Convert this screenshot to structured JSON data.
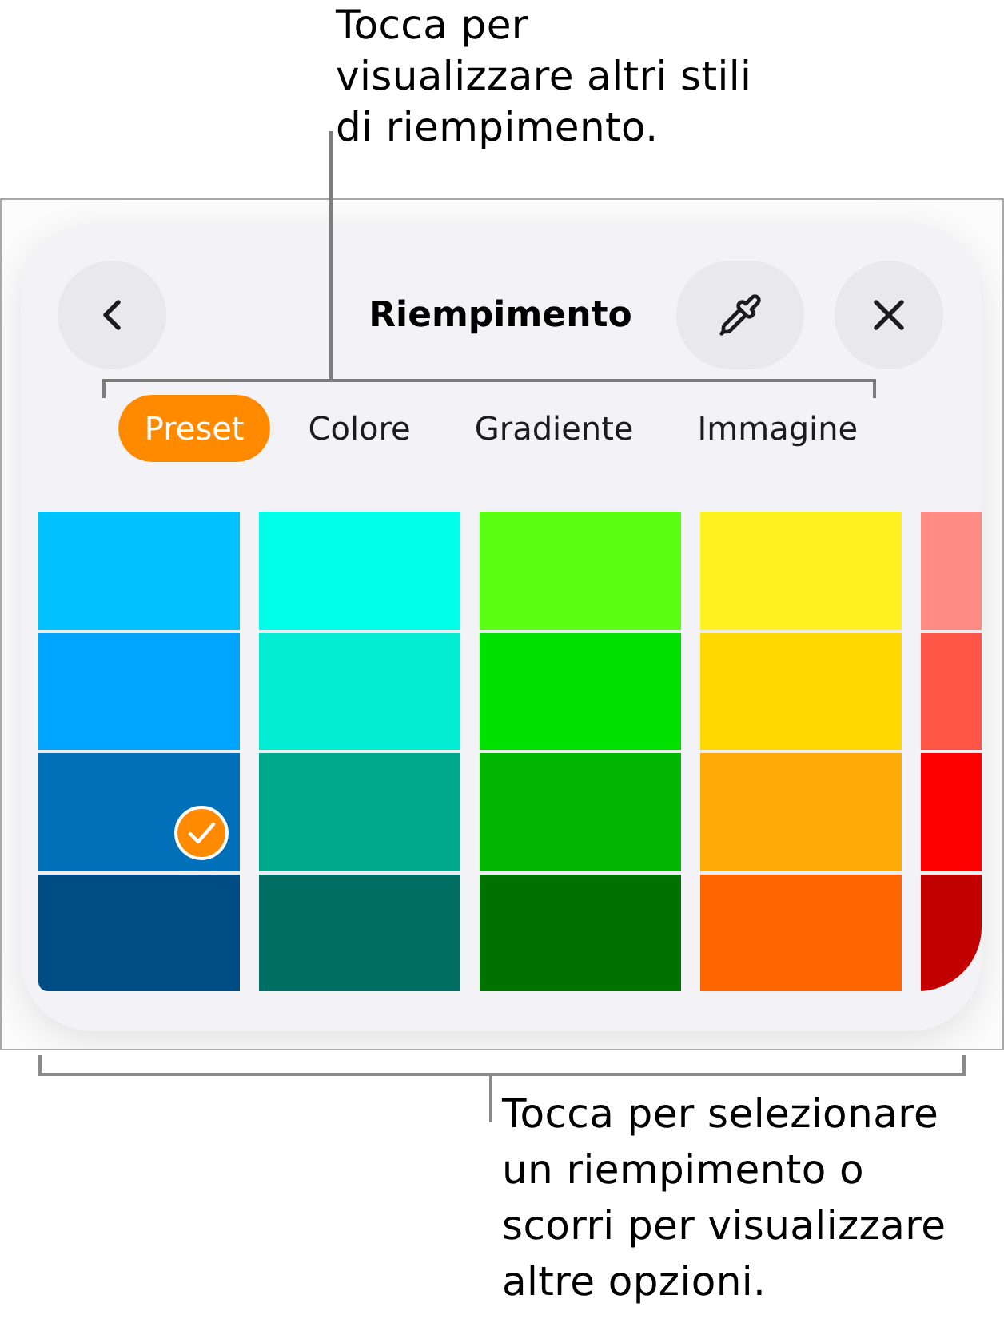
{
  "top_callout": {
    "text": "Tocca per\nvisualizzare altri stili\ndi riempimento."
  },
  "fill_panel": {
    "title": "Riempimento",
    "tabs": [
      {
        "label": "Preset",
        "selected": true
      },
      {
        "label": "Colore",
        "selected": false
      },
      {
        "label": "Gradiente",
        "selected": false
      },
      {
        "label": "Immagine",
        "selected": false
      }
    ],
    "swatch_columns": [
      {
        "swatches": [
          {
            "color": "#00c2ff",
            "selected": false
          },
          {
            "color": "#00a5ff",
            "selected": false
          },
          {
            "color": "#0071b9",
            "selected": true
          },
          {
            "color": "#004c85",
            "selected": false
          }
        ]
      },
      {
        "swatches": [
          {
            "color": "#00ffe9",
            "selected": false
          },
          {
            "color": "#00ecd3",
            "selected": false
          },
          {
            "color": "#00a98c",
            "selected": false
          },
          {
            "color": "#006e62",
            "selected": false
          }
        ]
      },
      {
        "swatches": [
          {
            "color": "#5aff14",
            "selected": false
          },
          {
            "color": "#00e100",
            "selected": false
          },
          {
            "color": "#00b600",
            "selected": false
          },
          {
            "color": "#007200",
            "selected": false
          }
        ]
      },
      {
        "swatches": [
          {
            "color": "#fff022",
            "selected": false
          },
          {
            "color": "#ffd800",
            "selected": false
          },
          {
            "color": "#ffaa06",
            "selected": false
          },
          {
            "color": "#ff6600",
            "selected": false
          }
        ]
      },
      {
        "swatches": [
          {
            "color": "#ff8b84",
            "selected": false
          },
          {
            "color": "#ff5547",
            "selected": false
          },
          {
            "color": "#ff0000",
            "selected": false
          },
          {
            "color": "#c20000",
            "selected": false
          }
        ]
      }
    ]
  },
  "bottom_callout": {
    "text": "Tocca per selezionare\nun riempimento o\nscorri per visualizzare\naltre opzioni."
  }
}
